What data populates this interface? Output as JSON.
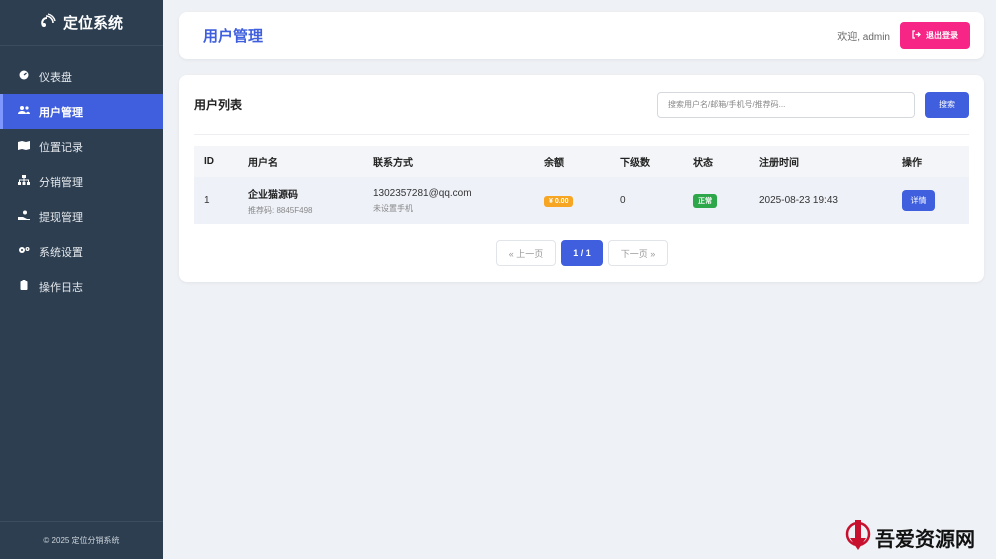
{
  "sidebar": {
    "brand": "定位系统",
    "items": [
      {
        "label": "仪表盘",
        "icon": "dashboard-icon"
      },
      {
        "label": "用户管理",
        "icon": "users-icon"
      },
      {
        "label": "位置记录",
        "icon": "map-marker-icon"
      },
      {
        "label": "分销管理",
        "icon": "sitemap-icon"
      },
      {
        "label": "提现管理",
        "icon": "withdraw-icon"
      },
      {
        "label": "系统设置",
        "icon": "gears-icon"
      },
      {
        "label": "操作日志",
        "icon": "clipboard-icon"
      }
    ],
    "active_index": 1,
    "footer": "© 2025 定位分销系统"
  },
  "header": {
    "title": "用户管理",
    "welcome": "欢迎, admin",
    "logout_label": "退出登录"
  },
  "user_list": {
    "title": "用户列表",
    "search_placeholder": "搜索用户名/邮箱/手机号/推荐码...",
    "search_button": "搜索",
    "columns": [
      "ID",
      "用户名",
      "联系方式",
      "余额",
      "下级数",
      "状态",
      "注册时间",
      "操作"
    ],
    "rows": [
      {
        "id": "1",
        "username": "企业猫源码",
        "referral": "推荐码: 8845F498",
        "email": "1302357281@qq.com",
        "phone": "未设置手机",
        "balance": "¥ 0.00",
        "subordinates": "0",
        "status": "正常",
        "registered": "2025-08-23 19:43",
        "action": "详情"
      }
    ]
  },
  "pagination": {
    "prev": "« 上一页",
    "current": "1 / 1",
    "next": "下一页 »"
  },
  "watermark": "吾爱资源网",
  "colors": {
    "sidebar_bg": "#2c3e50",
    "accent": "#3f5fde",
    "logout": "#f72585",
    "balance_badge": "#f6a623",
    "status_badge": "#2ea74a"
  }
}
